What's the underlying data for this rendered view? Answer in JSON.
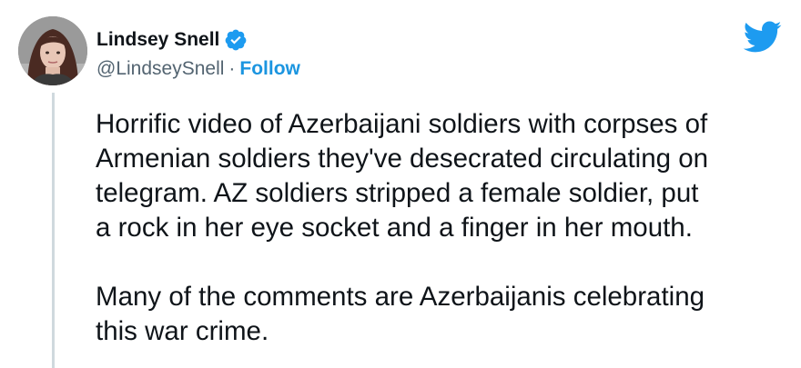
{
  "user": {
    "display_name": "Lindsey Snell",
    "handle": "@LindseySnell",
    "separator": "·",
    "follow_label": "Follow"
  },
  "icons": {
    "avatar": "profile-photo",
    "verified": "verified-badge-icon",
    "logo": "twitter-bird-icon"
  },
  "colors": {
    "accent": "#1b95e0",
    "verified": "#1d9bf0",
    "text": "#0f1419",
    "muted": "#536471"
  },
  "tweet": {
    "paragraph1": [
      "Horrific video of Azerbaijani soldiers with corpses of",
      "Armenian soldiers they've desecrated circulating on",
      "telegram. AZ soldiers stripped a female soldier, put",
      "a rock in her eye socket and a finger in her mouth."
    ],
    "paragraph2": [
      "Many of the comments are Azerbaijanis celebrating",
      "this war crime."
    ]
  }
}
